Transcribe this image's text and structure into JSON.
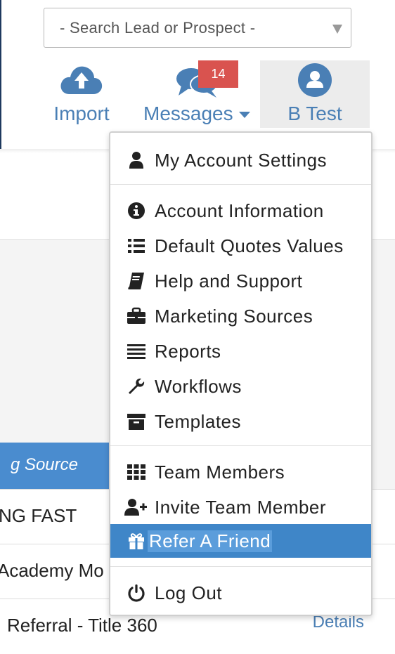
{
  "search": {
    "placeholder": "- Search Lead or Prospect -"
  },
  "nav": {
    "import_label": "Import",
    "messages_label": "Messages",
    "messages_badge": "14",
    "user_label": "B Test"
  },
  "menu": {
    "items": [
      {
        "label": "My Account Settings",
        "icon": "user-icon"
      },
      {
        "label": "Account Information",
        "icon": "info-circle-icon"
      },
      {
        "label": "Default Quotes Values",
        "icon": "list-icon"
      },
      {
        "label": "Help and Support",
        "icon": "book-icon"
      },
      {
        "label": "Marketing Sources",
        "icon": "briefcase-icon"
      },
      {
        "label": "Reports",
        "icon": "bars-icon"
      },
      {
        "label": "Workflows",
        "icon": "wrench-icon"
      },
      {
        "label": "Templates",
        "icon": "archive-icon"
      },
      {
        "label": "Team Members",
        "icon": "grid-icon"
      },
      {
        "label": "Invite Team Member",
        "icon": "user-plus-icon"
      },
      {
        "label": "Refer A Friend",
        "icon": "gift-icon"
      },
      {
        "label": "Log Out",
        "icon": "power-icon"
      }
    ]
  },
  "background": {
    "column_header": "g Source",
    "rows": [
      "NG FAST",
      "Academy Mo",
      "Referral - Title 360"
    ],
    "details_link": "Details"
  },
  "colors": {
    "accent": "#4a7fb5",
    "badge": "#d9534f",
    "active_item": "#3f86c8"
  }
}
